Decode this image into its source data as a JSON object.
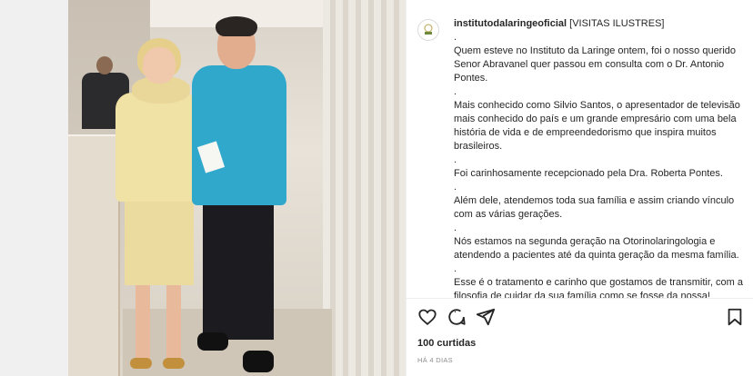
{
  "post": {
    "username": "institutodalaringeoficial",
    "tag": "[VISITAS ILUSTRES]",
    "caption": [
      ".",
      "Quem esteve no Instituto da Laringe ontem, foi o nosso querido Senor Abravanel quer passou em consulta com o Dr. Antonio Pontes.",
      ".",
      "Mais conhecido como Silvio Santos, o apresentador de televisão mais conhecido do país e um grande empresário com uma bela história de vida e de empreendedorismo que inspira muitos brasileiros.",
      ".",
      "Foi carinhosamente recepcionado pela Dra. Roberta Pontes.",
      ".",
      "Além dele, atendemos toda sua família e assim criando vínculo com as várias gerações.",
      ".",
      "Nós estamos na segunda geração na Otorinolaringologia e atendendo a pacientes até da quinta geração da mesma família.",
      ".",
      "Esse é o tratamento e carinho que gostamos de transmitir, com a filosofia de cuidar da sua família como se fosse da nossa!",
      "."
    ],
    "likes": "100 curtidas",
    "time": "HÁ 4 DIAS"
  },
  "icons": {
    "like": "heart-icon",
    "comment": "comment-icon",
    "share": "share-icon",
    "save": "bookmark-icon"
  }
}
